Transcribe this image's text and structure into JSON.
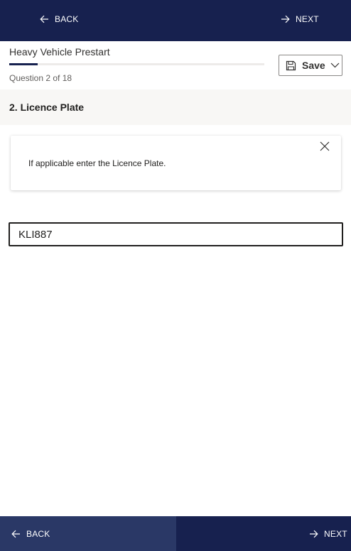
{
  "top_nav": {
    "back_label": "BACK",
    "next_label": "NEXT"
  },
  "header": {
    "form_title": "Heavy Vehicle Prestart",
    "question_counter": "Question 2 of 18",
    "progress": {
      "current": 2,
      "total": 18
    },
    "save_label": "Save"
  },
  "question": {
    "title": "2. Licence Plate",
    "info_text": "If applicable enter the Licence Plate.",
    "answer_value": "KLI887",
    "answer_placeholder": ""
  },
  "bottom_nav": {
    "back_label": "BACK",
    "next_label": "NEXT"
  },
  "colors": {
    "nav_background": "#17214f",
    "back_button_background": "#2a3866",
    "section_background": "#f8f7f5"
  },
  "icons": [
    "arrow-left-icon",
    "arrow-right-icon",
    "save-disk-icon",
    "chevron-down-icon",
    "close-icon"
  ]
}
